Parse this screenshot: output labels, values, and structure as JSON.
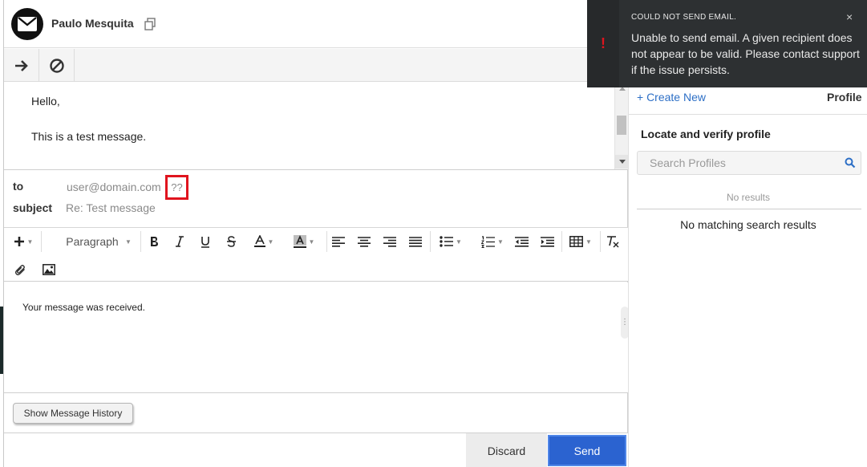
{
  "header": {
    "contact_name": "Paulo Mesquita"
  },
  "thread": {
    "lines": [
      "Hello,",
      "This is a test message."
    ]
  },
  "fields": {
    "to_label": "to",
    "to_value": "user@domain.com",
    "invalid_marker": "??",
    "subject_label": "subject",
    "subject_value": "Re: Test message"
  },
  "editor": {
    "paragraph_select": "Paragraph",
    "body_text": "Your message was received."
  },
  "history_button": "Show Message History",
  "footer": {
    "discard": "Discard",
    "send": "Send"
  },
  "right_panel": {
    "create_new": "+ Create New",
    "profile_tab": "Profile",
    "locate_title": "Locate and verify profile",
    "search_placeholder": "Search Profiles",
    "no_results": "No results",
    "no_matching": "No matching search results"
  },
  "toast": {
    "icon": "!",
    "title": "COULD NOT SEND EMAIL.",
    "close": "×",
    "message": "Unable to send email. A given recipient does not appear to be valid. Please contact support if the issue persists."
  },
  "colors": {
    "accent_blue": "#2b63d0",
    "link_blue": "#2d6fc6",
    "error_red": "#e0141e",
    "toast_bg": "#2d3032"
  },
  "icons": {
    "avatar": "envelope-icon",
    "copy": "copy-icon",
    "forward": "arrow-right-icon",
    "block": "block-icon",
    "search": "search-icon"
  }
}
